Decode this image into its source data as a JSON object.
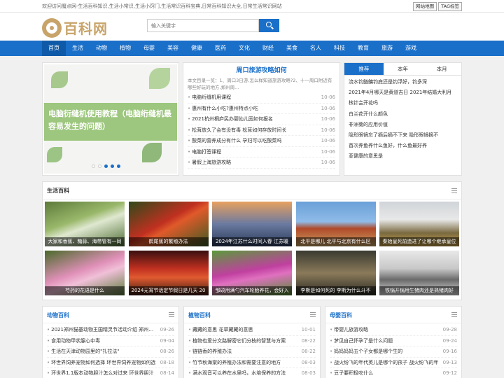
{
  "topbar": {
    "text": "欢迎访问魔点网-生活百科知识,生活小常识,生活小窍门,生活常识百科宝典,日常百科知识大全,日常生活常识网站",
    "links": [
      "网站地图",
      "TAG标签"
    ]
  },
  "logo": {
    "text": "百科网"
  },
  "search": {
    "placeholder": "输入关键字"
  },
  "nav": [
    "首页",
    "生活",
    "动物",
    "植物",
    "母婴",
    "美容",
    "健康",
    "医药",
    "文化",
    "财经",
    "美食",
    "名人",
    "科技",
    "教育",
    "旅游",
    "游戏"
  ],
  "slider": {
    "text": "电脑衍缝机使用教程（电脑绗缝机最容易发生的问题）"
  },
  "featured": {
    "title": "周口旅游攻略如何",
    "desc": "本文目录一览：1、周口3日游,怎么样知道旅游攻略?2、十一周口附近有哪些好玩的地方,郑州周...",
    "items": [
      {
        "t": "电脑绗缝机用课程",
        "d": "10-06"
      },
      {
        "t": "惠州有什么小吃?惠州特点小吃",
        "d": "10-06"
      },
      {
        "t": "2021杭州桐庐民办婴幼儿园如何报名",
        "d": "10-06"
      },
      {
        "t": "松茸放久了会有没有毒 松茸如何存放时间长",
        "d": "10-06"
      },
      {
        "t": "酸菜的营养成分有什么 孕妇可以吃酸菜吗",
        "d": "10-06"
      },
      {
        "t": "电脑打签课程",
        "d": "10-06"
      },
      {
        "t": "暑假上海旅游攻略",
        "d": "10-06"
      }
    ]
  },
  "rank": {
    "tabs": [
      "推荐",
      "本年",
      "本月"
    ],
    "items": [
      "流水钓鲢鳙钓底还是钓浮好，钓多深",
      "2021年4月哪天是黄道吉日 2021年结婚大利月",
      "核针会开花吗",
      "白兰花开什么颜色",
      "非洲菊的应用价值",
      "隐形眼镜忘了摘后摘不下来 隐形眼镜摘不",
      "首次养鱼养什么鱼好，什么鱼最好养",
      "亚健康的意思是"
    ]
  },
  "life": {
    "title": "生活百科",
    "tiles": [
      "大家和香蕉、糖蒜、海带管有一同",
      "鹤尾蕉的繁殖办法",
      "2024年江苏什么时间入春 江苏暖",
      "北平是哪儿 北平与北京有什么区",
      "秦始皇死前造进了让哪个继承皇位",
      "芍药的花语是什么",
      "2024元宵节话定节假日是几天 20",
      "邹硕用满勺汽车轮胎养花，会好入",
      "李斯是如何死的 李斯为什么斗不",
      "铁锅开锅用生猪肉还是熟猪肉好"
    ]
  },
  "cols": [
    {
      "title": "动物百科",
      "items": [
        {
          "t": "2021郑州猫基动物王国精灵节活动介绍 郑州猫基",
          "d": "09-26"
        },
        {
          "t": "食用动物甲状腺心中毒",
          "d": "09-04"
        },
        {
          "t": "生活在天津动物园里的\"扎拉法\"",
          "d": "08-26"
        },
        {
          "t": "环世界饲养宠物如何选择 环世界饲养宠物如何选",
          "d": "08-18"
        },
        {
          "t": "环世界1.1版本动物胆汁怎么对过来 环世界胆汁",
          "d": "08-14"
        }
      ]
    },
    {
      "title": "植物百科",
      "items": [
        {
          "t": "藏藏的意思 花草藏藏的意思",
          "d": "10-01"
        },
        {
          "t": "植物也爱分文路解密它们分枝的智慧与方案",
          "d": "08-22"
        },
        {
          "t": "链链香的养殖办法",
          "d": "08-22"
        },
        {
          "t": "竹节秋海棠的养殖办法和需要注意的地方",
          "d": "08-03"
        },
        {
          "t": "满水观音可以养在水里吗，水培保养的方法",
          "d": "08-03"
        }
      ]
    },
    {
      "title": "母婴百科",
      "items": [
        {
          "t": "带婴儿旅游攻略",
          "d": "09-28"
        },
        {
          "t": "梦见自己怀孕了是什么问题",
          "d": "09-24"
        },
        {
          "t": "妈妈妈妈五个子女都是哪个生的",
          "d": "09-16"
        },
        {
          "t": "战火纷飞的年代英儿是哪个的孩子 战火纷飞的年",
          "d": "09-13"
        },
        {
          "t": "豆子要积极吃什么",
          "d": "09-12"
        }
      ]
    }
  ]
}
